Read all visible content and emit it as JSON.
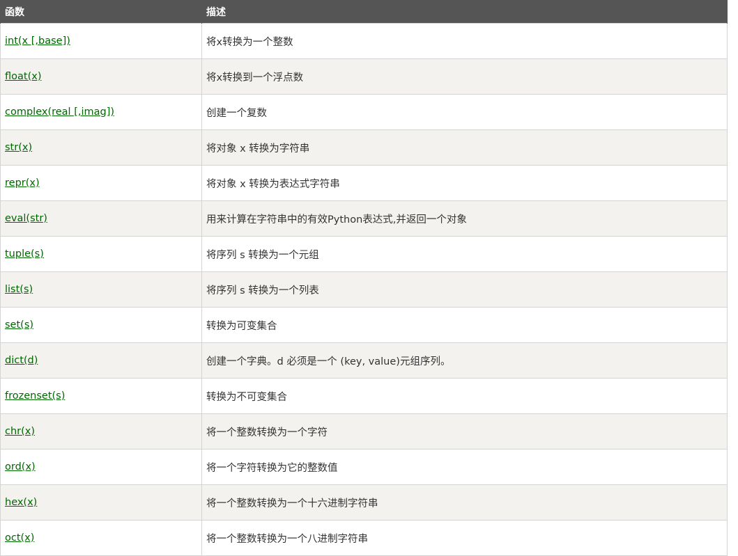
{
  "table": {
    "headers": [
      "函数",
      "描述"
    ],
    "rows": [
      {
        "func": "int(x [,base])",
        "desc": "将x转换为一个整数"
      },
      {
        "func": "float(x)",
        "desc": "将x转换到一个浮点数"
      },
      {
        "func": "complex(real [,imag])",
        "desc": "创建一个复数"
      },
      {
        "func": "str(x)",
        "desc": "将对象 x 转换为字符串"
      },
      {
        "func": "repr(x)",
        "desc": "将对象 x 转换为表达式字符串"
      },
      {
        "func": "eval(str)",
        "desc": "用来计算在字符串中的有效Python表达式,并返回一个对象"
      },
      {
        "func": "tuple(s)",
        "desc": "将序列 s 转换为一个元组"
      },
      {
        "func": "list(s)",
        "desc": "将序列 s 转换为一个列表"
      },
      {
        "func": "set(s)",
        "desc": "转换为可变集合"
      },
      {
        "func": "dict(d)",
        "desc": "创建一个字典。d 必须是一个 (key, value)元组序列。"
      },
      {
        "func": "frozenset(s)",
        "desc": "转换为不可变集合"
      },
      {
        "func": "chr(x)",
        "desc": "将一个整数转换为一个字符"
      },
      {
        "func": "ord(x)",
        "desc": "将一个字符转换为它的整数值"
      },
      {
        "func": "hex(x)",
        "desc": "将一个整数转换为一个十六进制字符串"
      },
      {
        "func": "oct(x)",
        "desc": "将一个整数转换为一个八进制字符串"
      }
    ]
  },
  "colors": {
    "header_bg": "#555555",
    "link": "#006600",
    "row_alt": "#f3f2ef"
  }
}
